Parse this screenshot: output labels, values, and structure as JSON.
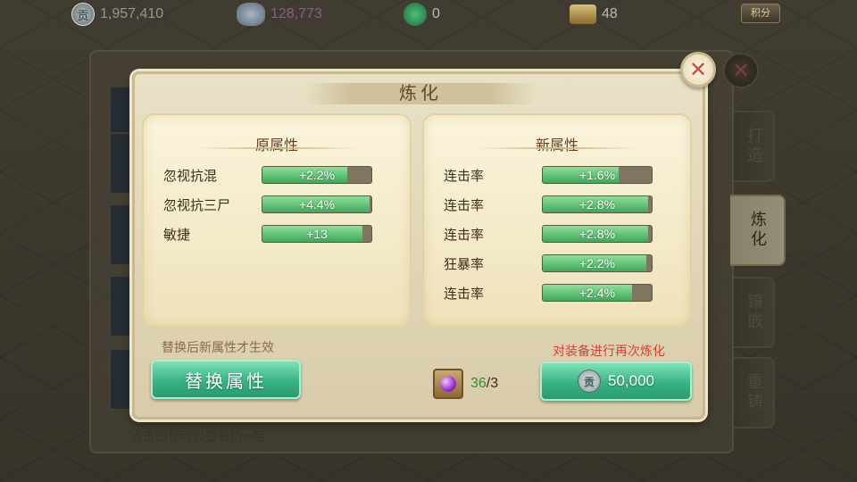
{
  "topbar": {
    "silver": {
      "icon": "silver-coin-icon",
      "glyph": "贡",
      "value": "1,957,410"
    },
    "ingot": {
      "icon": "silver-ingot-icon",
      "value": "128,773"
    },
    "jade": {
      "icon": "jade-icon",
      "value": "0"
    },
    "scroll": {
      "icon": "scroll-icon",
      "value": "48"
    },
    "points_label": "积分"
  },
  "background": {
    "title": "炼 化",
    "tip": "点击图标可以查看tips哦",
    "close_glyph": "✕"
  },
  "side_tabs": [
    {
      "label": "打造",
      "active": false
    },
    {
      "label": "炼化",
      "active": true
    },
    {
      "label": "镶嵌",
      "active": false
    },
    {
      "label": "重铸",
      "active": false
    }
  ],
  "dialog": {
    "title": "炼化",
    "close_glyph": "✕",
    "original": {
      "title": "原属性",
      "attributes": [
        {
          "name": "忽视抗混",
          "value": "+2.2%",
          "fill": 0.78
        },
        {
          "name": "忽视抗三尸",
          "value": "+4.4%",
          "fill": 0.98
        },
        {
          "name": "敏捷",
          "value": "+13",
          "fill": 0.92
        }
      ]
    },
    "new": {
      "title": "新属性",
      "attributes": [
        {
          "name": "连击率",
          "value": "+1.6%",
          "fill": 0.7
        },
        {
          "name": "连击率",
          "value": "+2.8%",
          "fill": 0.97
        },
        {
          "name": "连击率",
          "value": "+2.8%",
          "fill": 0.97
        },
        {
          "name": "狂暴率",
          "value": "+2.2%",
          "fill": 0.95
        },
        {
          "name": "连击率",
          "value": "+2.4%",
          "fill": 0.82
        }
      ]
    },
    "hint_left": "替换后新属性才生效",
    "hint_right": "对装备进行再次炼化",
    "replace_button": "替换属性",
    "gem": {
      "icon": "purple-gem-icon",
      "have": "36",
      "need": "/3"
    },
    "refine_button": {
      "coin_glyph": "贡",
      "cost": "50,000"
    }
  },
  "colors": {
    "accent_green": "#38b386",
    "hint_red": "#d84032",
    "title_brown": "#5e4a2c"
  }
}
